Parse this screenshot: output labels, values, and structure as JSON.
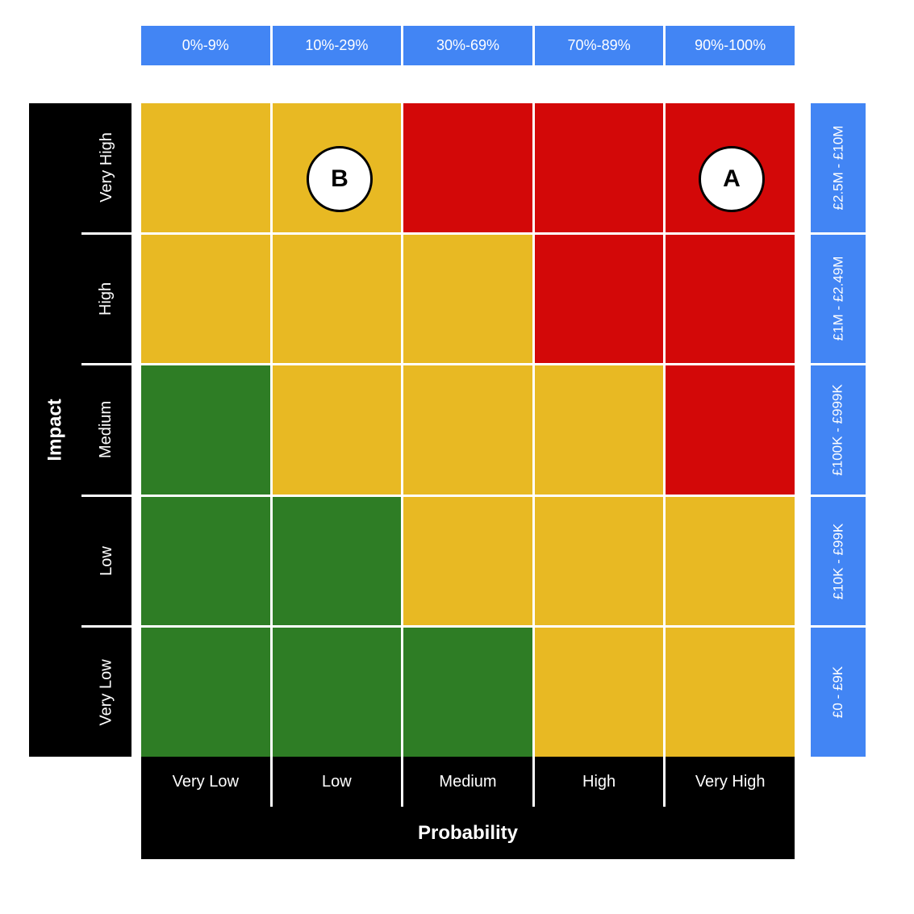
{
  "chart_data": {
    "type": "heatmap",
    "title": "",
    "xlabel": "Probability",
    "ylabel": "Impact",
    "x_categories": [
      "Very Low",
      "Low",
      "Medium",
      "High",
      "Very High"
    ],
    "x_ranges": [
      "0%-9%",
      "10%-29%",
      "30%-69%",
      "70%-89%",
      "90%-100%"
    ],
    "y_categories": [
      "Very High",
      "High",
      "Medium",
      "Low",
      "Very Low"
    ],
    "y_money": [
      "£2.5M - £10M",
      "£1M - £2.49M",
      "£100K - £999K",
      "£10K - £99K",
      "£0 - £9K"
    ],
    "legend": {
      "1": "green (low)",
      "2": "amber (medium)",
      "3": "red (high)"
    },
    "values": [
      [
        2,
        2,
        3,
        3,
        3
      ],
      [
        2,
        2,
        2,
        3,
        3
      ],
      [
        1,
        2,
        2,
        2,
        3
      ],
      [
        1,
        1,
        2,
        2,
        2
      ],
      [
        1,
        1,
        1,
        2,
        2
      ]
    ],
    "markers": [
      {
        "label": "A",
        "x": "Very High",
        "y": "Very High"
      },
      {
        "label": "B",
        "x": "Low",
        "y": "Very High"
      }
    ]
  },
  "colors": {
    "1": "g",
    "2": "y",
    "3": "r",
    "band": "black",
    "header": "blue"
  }
}
